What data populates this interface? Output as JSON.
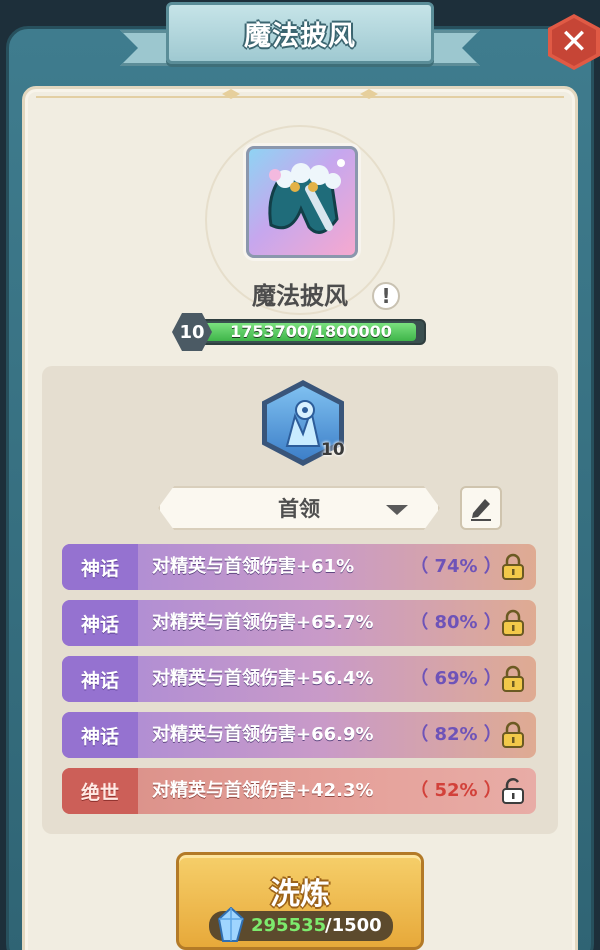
{
  "title": "魔法披风",
  "close_icon": "close-icon",
  "item": {
    "name": "魔法披风",
    "icon": "cape-icon",
    "info_icon_glyph": "!",
    "level": "10",
    "xp_text": "1753700/1800000",
    "xp_progress": 0.974
  },
  "skill": {
    "icon": "ice-skill-icon",
    "level": "10"
  },
  "filter": {
    "selected": "首领",
    "edit_icon": "pencil-icon"
  },
  "attributes": [
    {
      "tier": "神话",
      "text": "对精英与首领伤害+61%",
      "percent": "（ 74% ）",
      "locked": true
    },
    {
      "tier": "神话",
      "text": "对精英与首领伤害+65.7%",
      "percent": "（ 80% ）",
      "locked": true
    },
    {
      "tier": "神话",
      "text": "对精英与首领伤害+56.4%",
      "percent": "（ 69% ）",
      "locked": true
    },
    {
      "tier": "神话",
      "text": "对精英与首领伤害+66.9%",
      "percent": "（ 82% ）",
      "locked": true
    },
    {
      "tier": "绝世",
      "text": "对精英与首领伤害+42.3%",
      "percent": "（ 52% ）",
      "locked": false
    }
  ],
  "refine": {
    "label": "洗炼",
    "owned": "295535",
    "cost": "/1500",
    "currency_icon": "crystal-icon"
  },
  "colors": {
    "mythic": "#9572d0",
    "peerless": "#cc5f58",
    "button": "#e7a93a",
    "xp": "#3fb54a"
  }
}
